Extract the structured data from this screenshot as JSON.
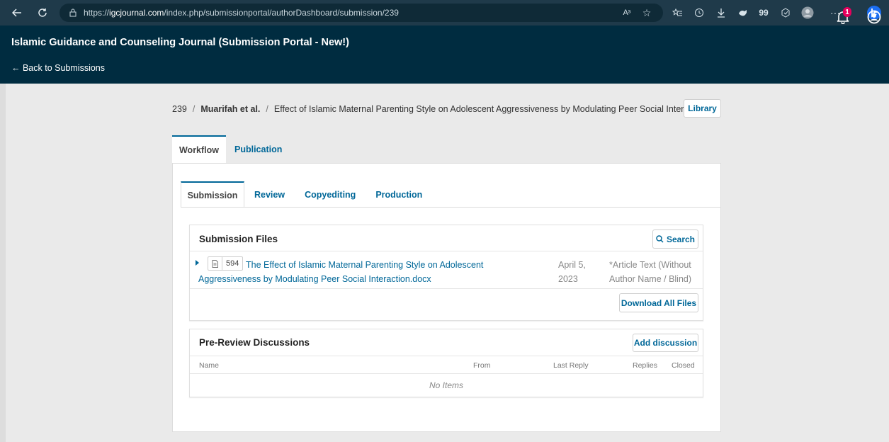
{
  "browser": {
    "url_prefix": "https://",
    "url_host": "igcjournal.com",
    "url_path": "/index.php/submissionportal/authorDashboard/submission/239",
    "icons": [
      "back-icon",
      "refresh-icon",
      "lock-icon",
      "read-aloud-icon",
      "favorite-icon",
      "favorites-bar-icon",
      "history-icon",
      "downloads-icon",
      "extensions-icon",
      "quote-icon",
      "browser-essentials-icon",
      "profile-icon",
      "more-icon",
      "bing-icon"
    ],
    "tool_glyphs": {
      "read_aloud": "Aˢ",
      "quote": "99",
      "more": "···"
    }
  },
  "header": {
    "title": "Islamic Guidance and Counseling Journal (Submission Portal - New!)",
    "back_link": "← Back to Submissions",
    "notification_count": "1"
  },
  "breadcrumb": {
    "id": "239",
    "authors": "Muarifah et al.",
    "title": "Effect of Islamic Maternal Parenting Style on Adolescent Aggressiveness by Modulating Peer Social Interaction",
    "library_label": "Library",
    "separator": "/"
  },
  "outer_tabs": [
    {
      "label": "Workflow",
      "active": true
    },
    {
      "label": "Publication",
      "active": false
    }
  ],
  "inner_tabs": [
    {
      "label": "Submission",
      "active": true
    },
    {
      "label": "Review",
      "active": false
    },
    {
      "label": "Copyediting",
      "active": false
    },
    {
      "label": "Production",
      "active": false
    }
  ],
  "submission_files": {
    "title": "Submission Files",
    "search_label": "Search",
    "files": [
      {
        "id": "594",
        "name": "The Effect of Islamic Maternal Parenting Style on Adolescent Aggressiveness by Modulating Peer Social Interaction.docx",
        "date": "April 5, 2023",
        "genre": "*Article Text (Without Author Name / Blind)"
      }
    ],
    "download_all_label": "Download All Files"
  },
  "discussions": {
    "title": "Pre-Review Discussions",
    "add_label": "Add discussion",
    "columns": [
      "Name",
      "From",
      "Last Reply",
      "Replies",
      "Closed"
    ],
    "empty_text": "No Items"
  },
  "colors": {
    "header_bg": "#002c40",
    "link": "#006798",
    "badge": "#e6005c"
  }
}
